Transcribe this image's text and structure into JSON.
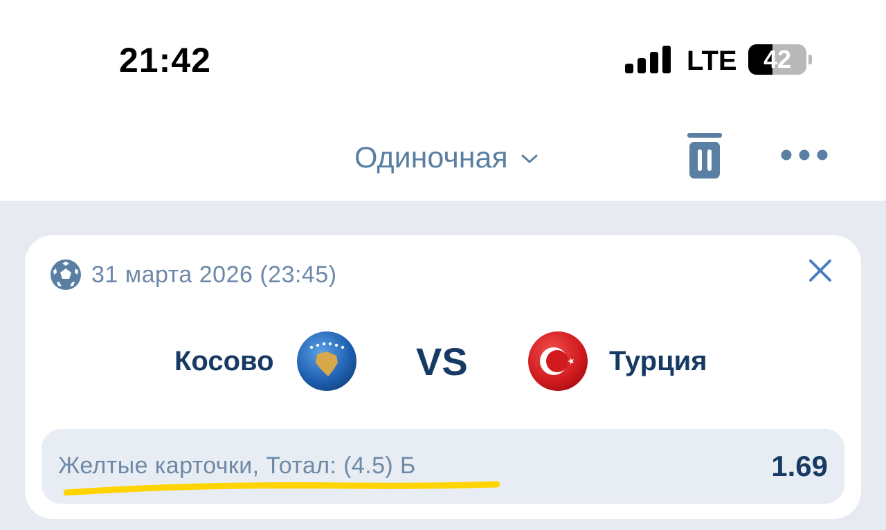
{
  "status_bar": {
    "time": "21:42",
    "network": "LTE",
    "battery_percent": "42",
    "battery_level": 0.42,
    "icons": [
      "signal-icon",
      "battery-icon"
    ]
  },
  "header": {
    "bet_type_label": "Одиночная",
    "icons": [
      "chevron-down-icon",
      "trash-icon",
      "more-icon"
    ]
  },
  "bet": {
    "date": "31 марта 2026 (23:45)",
    "home_team": "Косово",
    "vs_label": "VS",
    "away_team": "Турция",
    "market": "Желтые карточки, Тотал: (4.5) Б",
    "odds": "1.69",
    "icons": [
      "soccer-ball-icon",
      "close-icon",
      "kosovo-flag-icon",
      "turkey-flag-icon"
    ]
  },
  "colors": {
    "accent": "#5a7fa3",
    "team_text": "#173a64",
    "muted_text": "#6d89a7",
    "background": "#e7ebf1",
    "highlight": "#ffd400"
  }
}
